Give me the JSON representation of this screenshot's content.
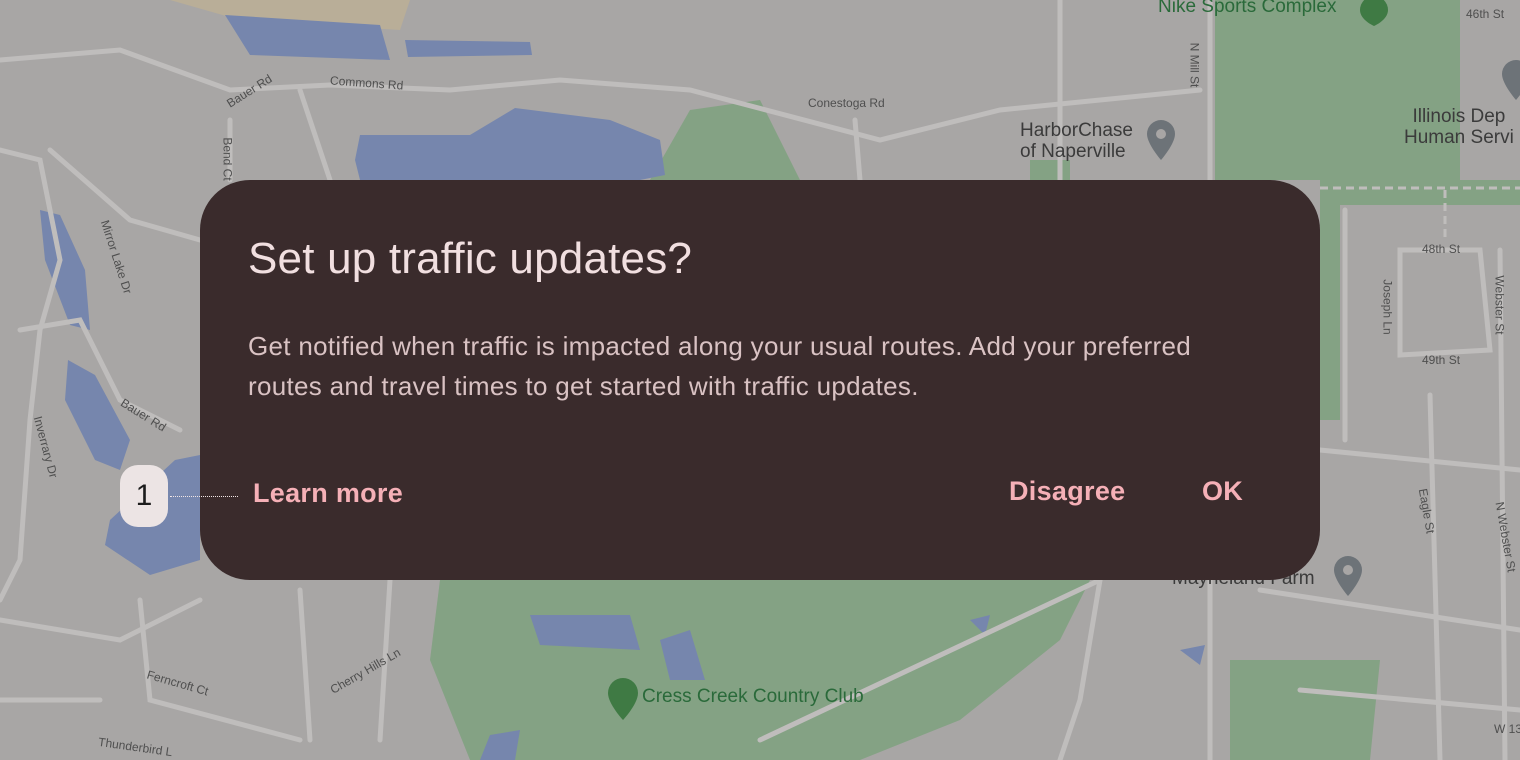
{
  "map": {
    "labels": {
      "bauer_rd_top": "Bauer Rd",
      "commons_rd": "Commons Rd",
      "conestoga_rd": "Conestoga Rd",
      "harborchase": "HarborChase\nof Naperville",
      "nike": "Nike Sports Complex",
      "n_mill_st": "N Mill St",
      "st_46th": "46th St",
      "illinois": "Illinois Dep\nHuman Servi",
      "st_48th": "48th St",
      "st_49th": "49th St",
      "joseph_ln": "Joseph Ln",
      "webster_st": "Webster St",
      "mirror_lake": "Mirror Lake Dr",
      "bend_ct": "Bend Ct",
      "bauer_rd": "Bauer Rd",
      "inverrary": "Inverrary Dr",
      "eagle_st": "Eagle St",
      "n_webster": "N Webster St",
      "mayneland": "Mayneland Farm",
      "cherry_hills": "Cherry Hills Ln",
      "ferncroft": "Ferncroft Ct",
      "cress_creek": "Cress Creek Country Club",
      "thunderbird": "Thunderbird L",
      "w13": "W 13"
    },
    "colors": {
      "land": "#a8a6a5",
      "road": "#bdbbba",
      "water": "#7686ad",
      "park": "#84a284",
      "pin": "#6d7378",
      "pin_green": "#3f7a44"
    }
  },
  "dialog": {
    "title": "Set up traffic updates?",
    "body": "Get notified when traffic is impacted along your usual routes. Add your preferred routes and travel times to get started with traffic updates.",
    "learn_more": "Learn more",
    "disagree": "Disagree",
    "ok": "OK"
  },
  "marker": {
    "label": "1"
  },
  "colors": {
    "dialog_bg": "#3a2b2c",
    "title": "#f1dfe0",
    "body": "#d9c2c3",
    "accent": "#f5b0b7"
  }
}
